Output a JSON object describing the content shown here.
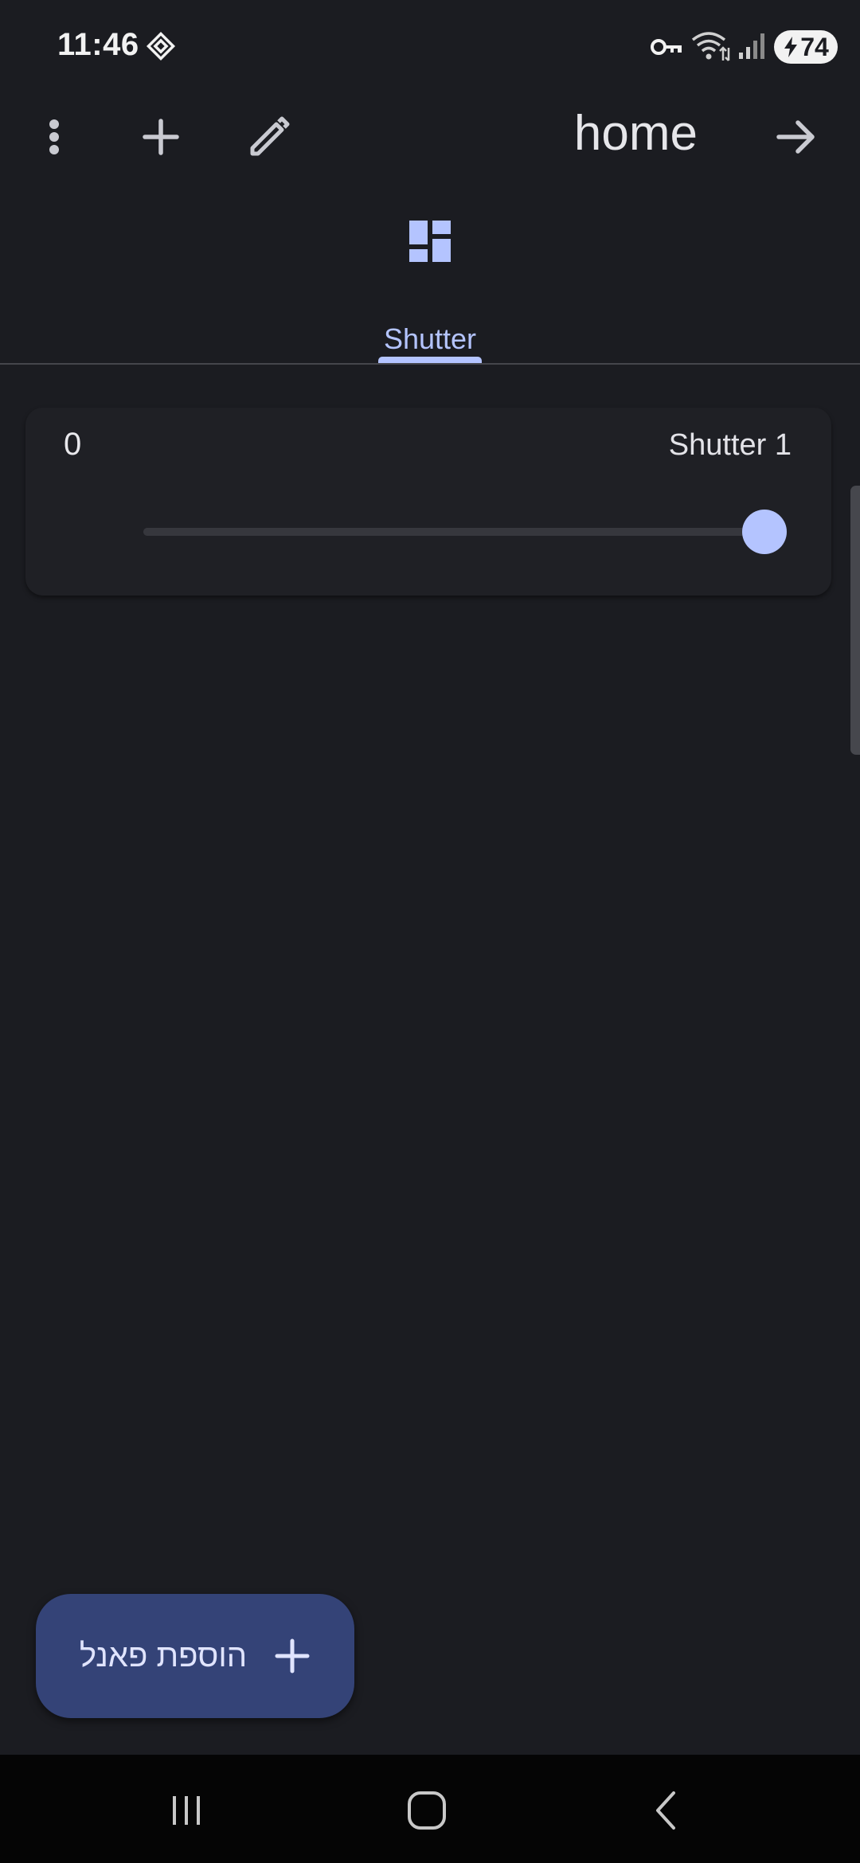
{
  "status_bar": {
    "time": "11:46",
    "battery_level": "74",
    "icons": [
      "app-notification-icon",
      "vpn-key-icon",
      "wifi-icon",
      "signal-icon",
      "battery-charging-icon"
    ]
  },
  "top_bar": {
    "title": "home",
    "icons": [
      "more-vert-icon",
      "add-icon",
      "edit-pencil-icon",
      "arrow-forward-icon"
    ]
  },
  "tabs": [
    {
      "label": "Shutter",
      "icon": "dashboard-icon",
      "selected": true
    }
  ],
  "cards": [
    {
      "value": "0",
      "name": "Shutter 1",
      "slider_position": 1.0
    }
  ],
  "fab": {
    "label": "הוספת פאנל",
    "icon": "add-icon"
  },
  "nav_bar": {
    "icons": [
      "recents-icon",
      "home-icon",
      "back-icon"
    ]
  },
  "colors": {
    "background": "#1b1c21",
    "accent": "#b4c4ff",
    "fab": "#344377",
    "card": "#1f2025"
  }
}
